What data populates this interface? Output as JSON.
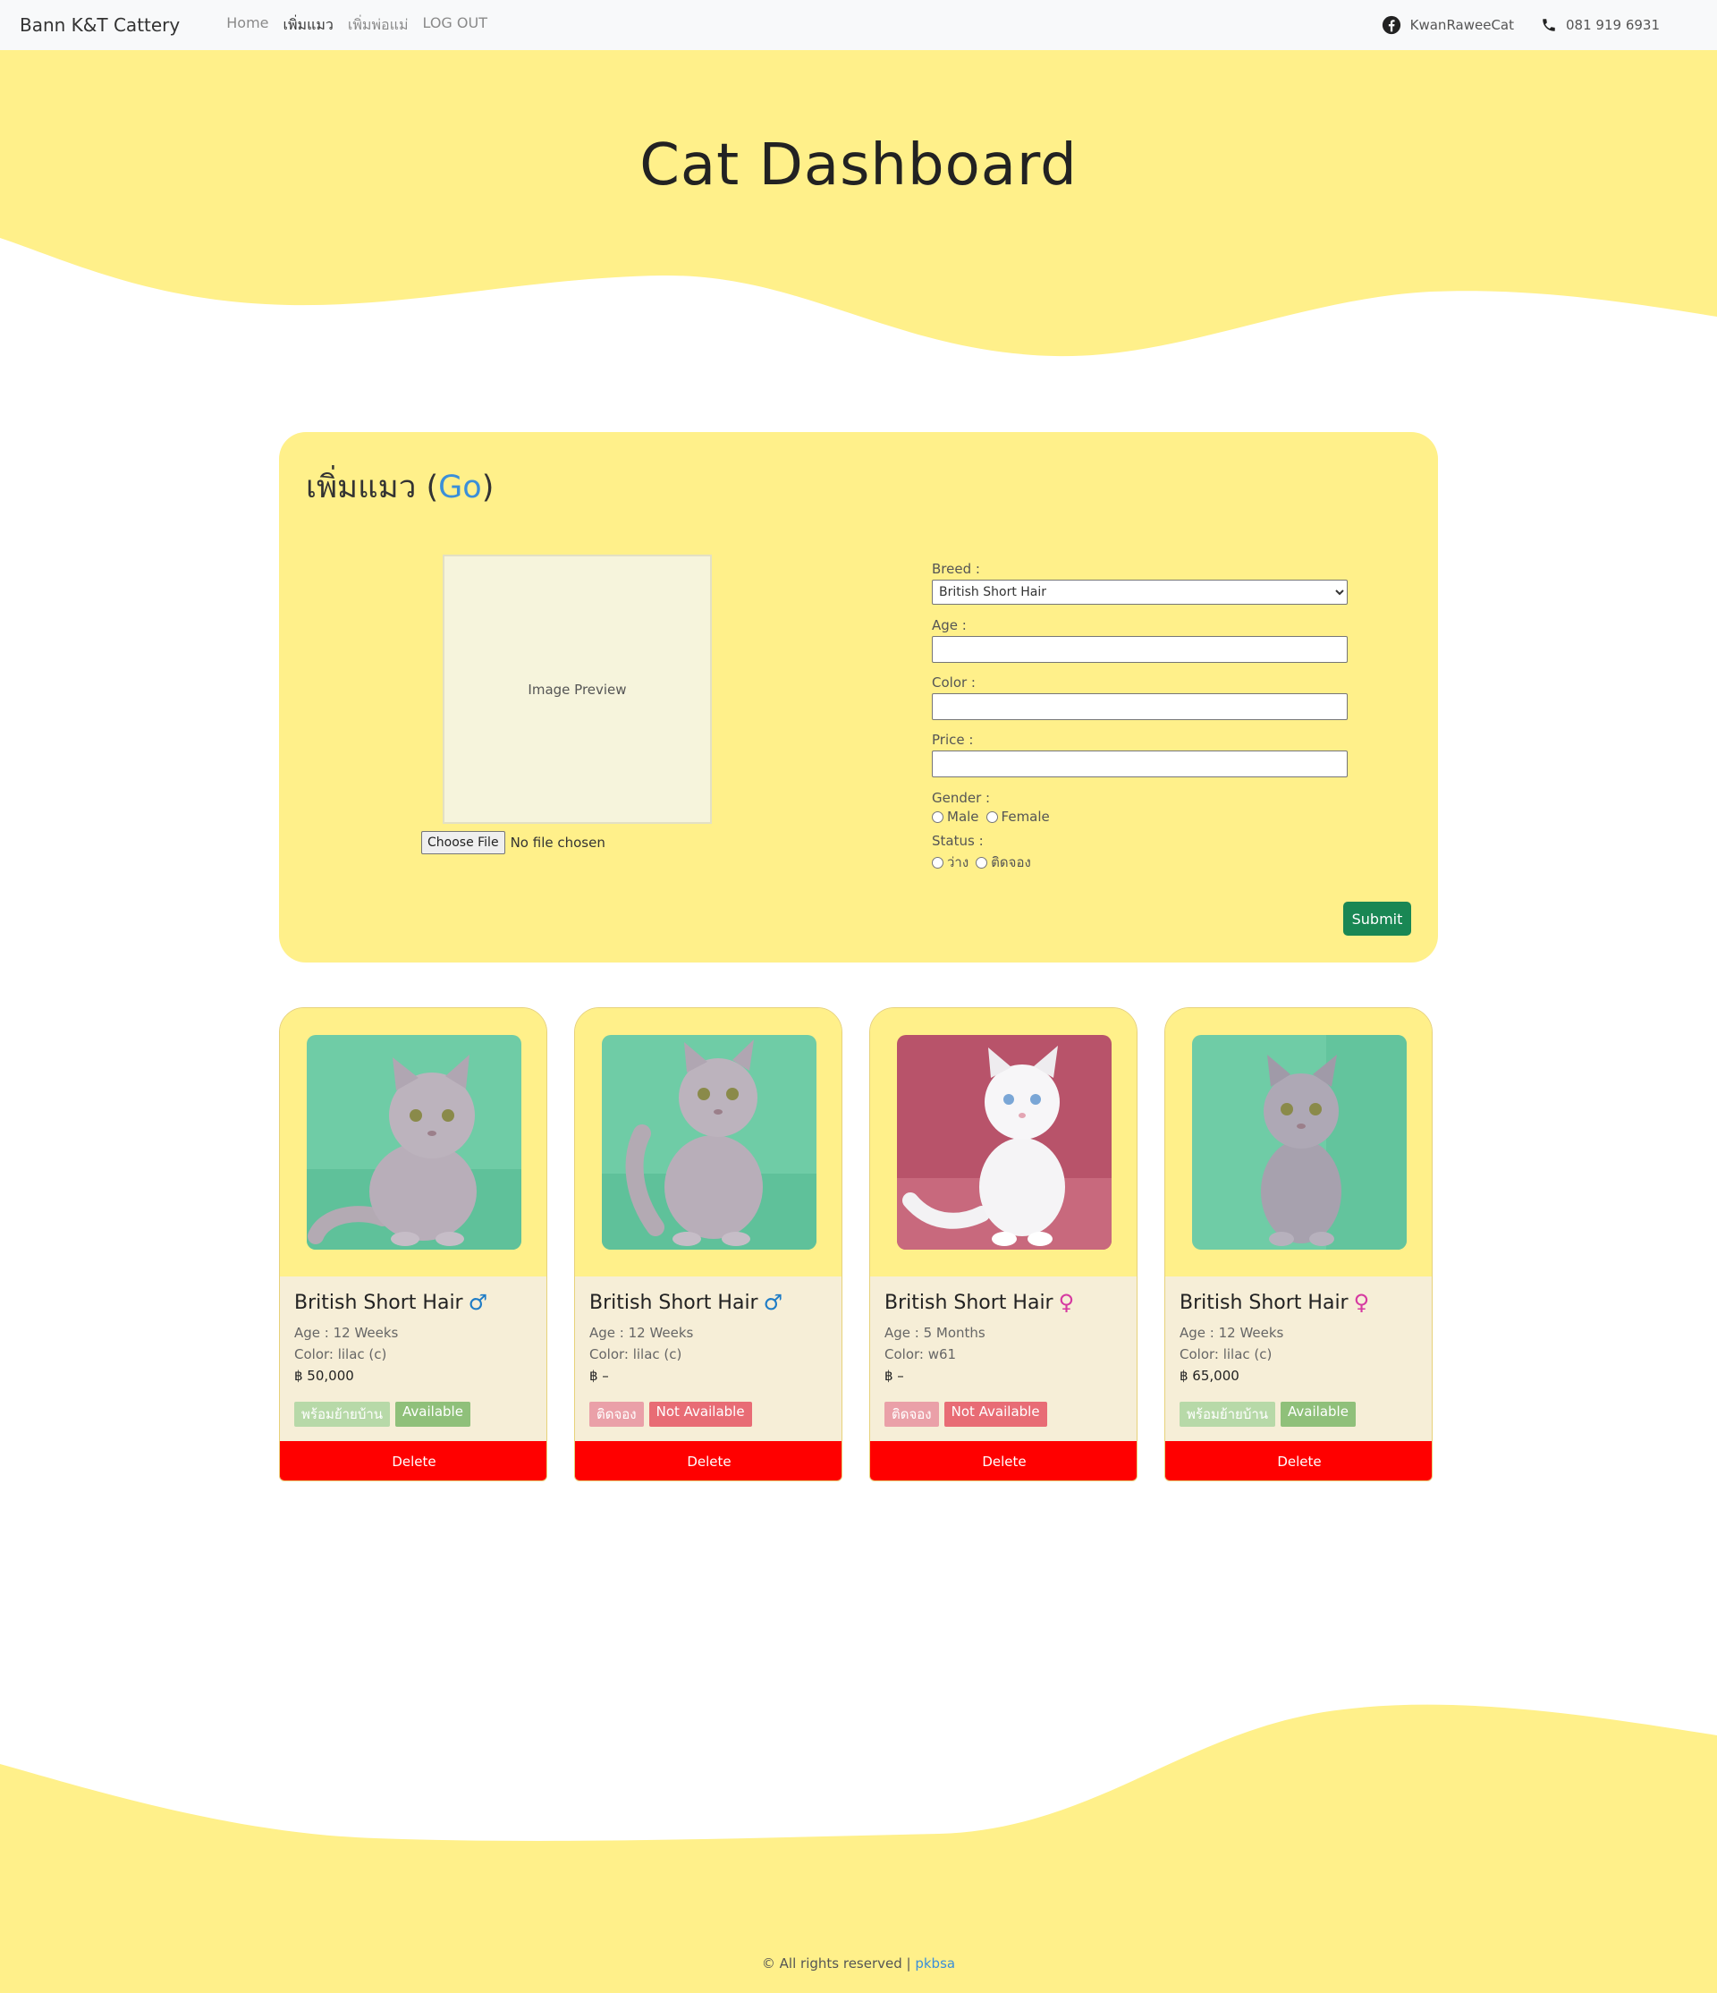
{
  "navbar": {
    "brand": "Bann K&T Cattery",
    "links": [
      "Home",
      "เพิ่มแมว",
      "เพิ่มพ่อแม่",
      "LOG OUT"
    ],
    "facebook": "KwanRaweeCat",
    "phone": "081 919 6931"
  },
  "hero": {
    "title": "Cat Dashboard"
  },
  "form": {
    "title": "เพิ่มแมว (",
    "title_link": "Go",
    "title_end": ")",
    "preview_text": "Image Preview",
    "file_button": "Choose File",
    "file_status": "No file chosen",
    "breed_label": "Breed :",
    "breed_value": "British Short Hair",
    "age_label": "Age :",
    "color_label": "Color :",
    "price_label": "Price :",
    "gender_label": "Gender :",
    "gender_options": [
      "Male",
      "Female"
    ],
    "status_label": "Status :",
    "status_options": [
      "ว่าง",
      "ติดจอง"
    ],
    "submit": "Submit"
  },
  "cats": [
    {
      "name": "British Short Hair",
      "gender": "♂",
      "age": "Age : 12 Weeks",
      "color": "Color: lilac (c)",
      "price": "฿ 50,000",
      "badge1": "พร้อมย้ายบ้าน",
      "badge2": "Available",
      "delete": "Delete"
    },
    {
      "name": "British Short Hair",
      "gender": "♂",
      "age": "Age : 12 Weeks",
      "color": "Color: lilac (c)",
      "price": "฿ –",
      "badge1": "ติดจอง",
      "badge2": "Not Available",
      "delete": "Delete"
    },
    {
      "name": "British Short Hair",
      "gender": "♀",
      "age": "Age : 5 Months",
      "color": "Color: w61",
      "price": "฿ –",
      "badge1": "ติดจอง",
      "badge2": "Not Available",
      "delete": "Delete"
    },
    {
      "name": "British Short Hair",
      "gender": "♀",
      "age": "Age : 12 Weeks",
      "color": "Color: lilac (c)",
      "price": "฿ 65,000",
      "badge1": "พร้อมย้ายบ้าน",
      "badge2": "Available",
      "delete": "Delete"
    }
  ],
  "footer": {
    "text": "© All rights reserved | ",
    "link": "pkbsa"
  },
  "colors": {
    "accent": "#fff08a",
    "submit": "#198754",
    "delete": "#ff0000",
    "link": "#3b8fd9"
  }
}
